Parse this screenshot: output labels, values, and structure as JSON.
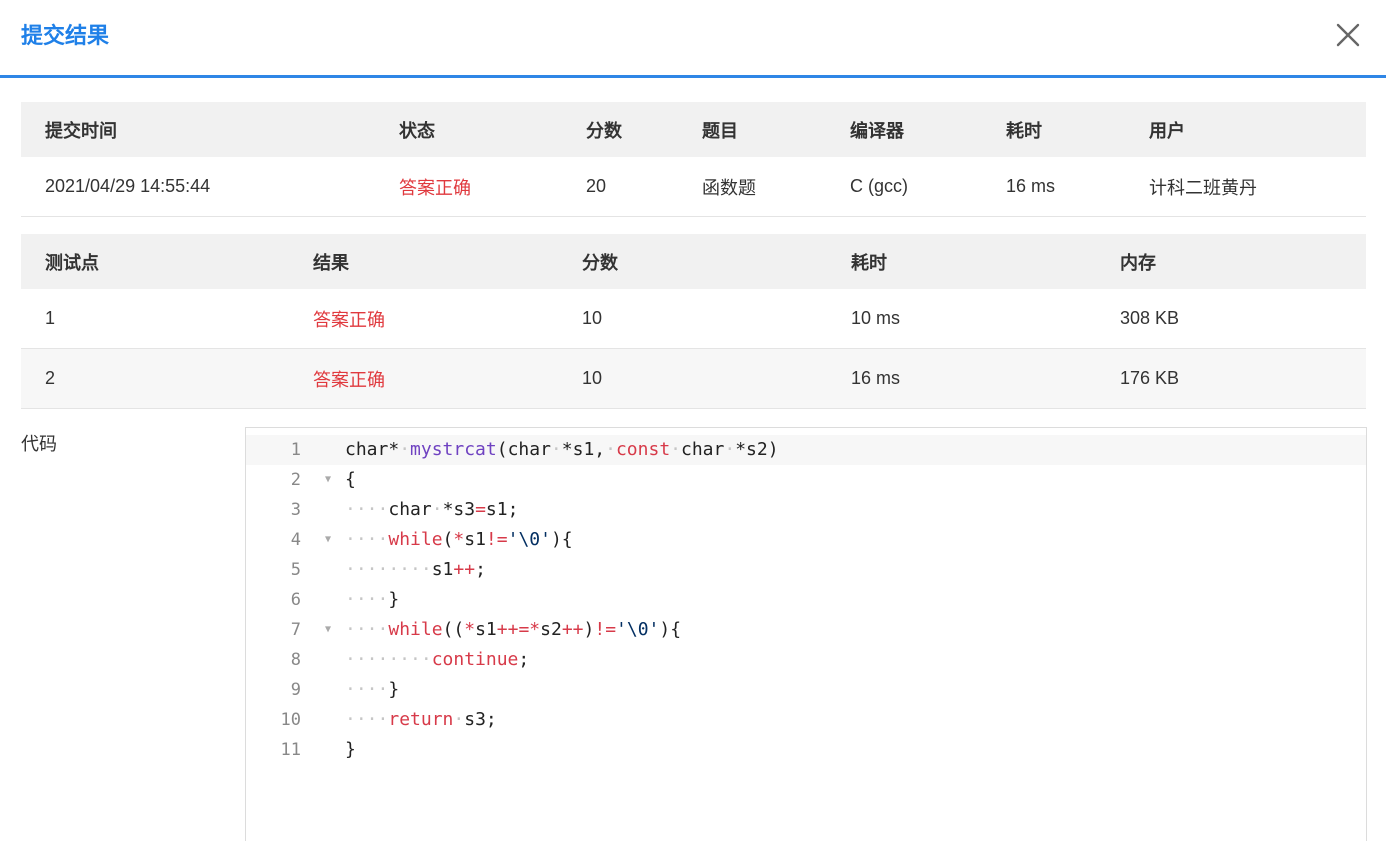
{
  "dialog": {
    "title": "提交结果"
  },
  "summary": {
    "headers": [
      "提交时间",
      "状态",
      "分数",
      "题目",
      "编译器",
      "耗时",
      "用户"
    ],
    "row": [
      "2021/04/29 14:55:44",
      "答案正确",
      "20",
      "函数题",
      "C (gcc)",
      "16 ms",
      "计科二班黄丹"
    ]
  },
  "tests": {
    "headers": [
      "测试点",
      "结果",
      "分数",
      "耗时",
      "内存"
    ],
    "rows": [
      [
        "1",
        "答案正确",
        "10",
        "10 ms",
        "308 KB"
      ],
      [
        "2",
        "答案正确",
        "10",
        "16 ms",
        "176 KB"
      ]
    ]
  },
  "code": {
    "label": "代码",
    "line_numbers": [
      "1",
      "2",
      "3",
      "4",
      "5",
      "6",
      "7",
      "8",
      "9",
      "10",
      "11"
    ],
    "lines": [
      "char* mystrcat(char *s1, const char *s2)",
      "{",
      "    char *s3=s1;",
      "    while(*s1!='\\0'){",
      "        s1++;",
      "    }",
      "    while((*s1++=*s2++)!='\\0'){",
      "        continue;",
      "    }",
      "    return s3;",
      "}"
    ]
  },
  "colors": {
    "accent": "#1f80e8",
    "status_ok": "#e0393e"
  },
  "icons": {
    "close": "close-icon",
    "fold": "fold-arrow-icon"
  }
}
